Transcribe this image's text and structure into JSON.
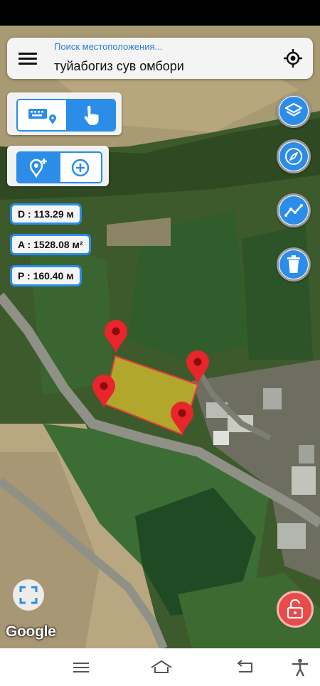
{
  "search": {
    "placeholder": "Поиск местоположения...",
    "value": "туйабогиз сув омбори"
  },
  "measurements": {
    "distance": "D : 113.29 м",
    "area": "A : 1528.08 м²",
    "perimeter": "P : 160.40 м"
  },
  "map": {
    "attribution": "Google",
    "polygon_fill": "#d8c22c",
    "polygon_stroke": "#e83c3c",
    "marker_color": "#e8252a",
    "marker_count": 4
  },
  "input_mode": {
    "options": [
      "keyboard-gps-icon",
      "touch-icon"
    ],
    "selected": "touch-icon"
  },
  "point_mode": {
    "options": [
      "add-marker-icon",
      "add-point-icon"
    ],
    "selected": "add-marker-icon"
  },
  "right_tools": [
    "layers-icon",
    "compass-icon",
    "path-icon",
    "trash-icon"
  ],
  "accent_color": "#2b8de8",
  "lock_color": "#e84b4b",
  "navbar": [
    "menu-icon",
    "home-icon",
    "back-icon",
    "accessibility-icon"
  ]
}
